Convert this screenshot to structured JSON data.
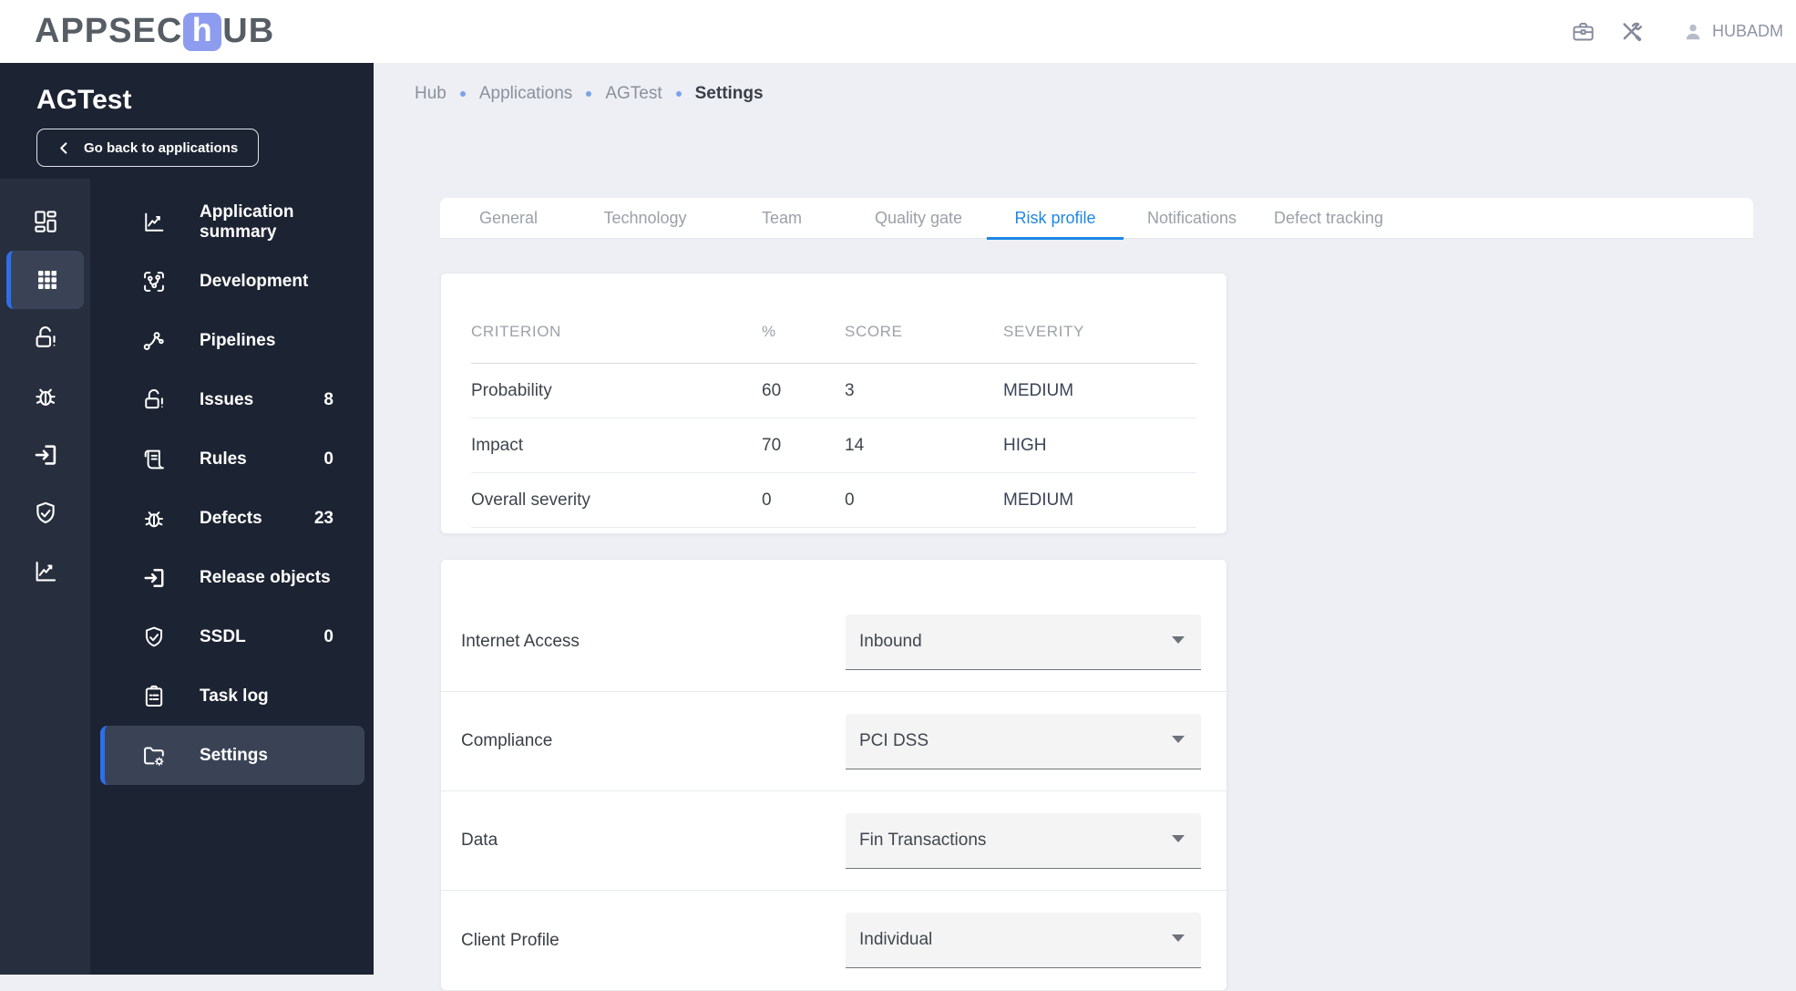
{
  "header": {
    "logo_part1": "APPSEC",
    "logo_accent": "h",
    "logo_part2": "UB",
    "icons": [
      "briefcase-icon",
      "tools-icon"
    ],
    "user_name": "HUBADM"
  },
  "sidebar": {
    "app_name": "AGTest",
    "back_button_label": "Go back to applications",
    "rail": [
      {
        "id": "dashboard",
        "icon": "dashboard-icon",
        "active": false
      },
      {
        "id": "applications",
        "icon": "grid-icon",
        "active": true
      },
      {
        "id": "issues",
        "icon": "lock-alert-icon",
        "active": false
      },
      {
        "id": "defects",
        "icon": "bug-icon",
        "active": false
      },
      {
        "id": "release-objects",
        "icon": "box-arrow-icon",
        "active": false
      },
      {
        "id": "ssdl",
        "icon": "shield-check-icon",
        "active": false
      },
      {
        "id": "summary",
        "icon": "chart-line-icon",
        "active": false
      }
    ],
    "menu": [
      {
        "id": "application-summary",
        "icon": "chart-line-icon",
        "label": "Application summary",
        "count": "",
        "active": false
      },
      {
        "id": "development",
        "icon": "dev-icon",
        "label": "Development",
        "count": "",
        "active": false
      },
      {
        "id": "pipelines",
        "icon": "pipelines-icon",
        "label": "Pipelines",
        "count": "",
        "active": false
      },
      {
        "id": "issues",
        "icon": "lock-alert-icon",
        "label": "Issues",
        "count": "8",
        "active": false
      },
      {
        "id": "rules",
        "icon": "rules-icon",
        "label": "Rules",
        "count": "0",
        "active": false
      },
      {
        "id": "defects",
        "icon": "bug-icon",
        "label": "Defects",
        "count": "23",
        "active": false
      },
      {
        "id": "release-objects",
        "icon": "box-arrow-icon",
        "label": "Release objects",
        "count": "",
        "active": false
      },
      {
        "id": "ssdl",
        "icon": "shield-check-icon",
        "label": "SSDL",
        "count": "0",
        "active": false
      },
      {
        "id": "task-log",
        "icon": "task-log-icon",
        "label": "Task log",
        "count": "",
        "active": false
      },
      {
        "id": "settings",
        "icon": "folder-gear-icon",
        "label": "Settings",
        "count": "",
        "active": true
      }
    ]
  },
  "breadcrumb": [
    {
      "label": "Hub",
      "current": false
    },
    {
      "label": "Applications",
      "current": false
    },
    {
      "label": "AGTest",
      "current": false
    },
    {
      "label": "Settings",
      "current": true
    }
  ],
  "tabs": [
    {
      "label": "General",
      "active": false
    },
    {
      "label": "Technology",
      "active": false
    },
    {
      "label": "Team",
      "active": false
    },
    {
      "label": "Quality gate",
      "active": false
    },
    {
      "label": "Risk profile",
      "active": true
    },
    {
      "label": "Notifications",
      "active": false
    },
    {
      "label": "Defect tracking",
      "active": false
    }
  ],
  "risk_table": {
    "columns": [
      "CRITERION",
      "%",
      "SCORE",
      "SEVERITY"
    ],
    "rows": [
      {
        "criterion": "Probability",
        "percent": "60",
        "score": "3",
        "severity": "MEDIUM"
      },
      {
        "criterion": "Impact",
        "percent": "70",
        "score": "14",
        "severity": "HIGH"
      },
      {
        "criterion": "Overall severity",
        "percent": "0",
        "score": "0",
        "severity": "MEDIUM"
      }
    ]
  },
  "risk_form": {
    "fields": [
      {
        "label": "Internet Access",
        "value": "Inbound"
      },
      {
        "label": "Compliance",
        "value": "PCI DSS"
      },
      {
        "label": "Data",
        "value": "Fin Transactions"
      },
      {
        "label": "Client Profile",
        "value": "Individual"
      }
    ]
  },
  "colors": {
    "accent_blue": "#2c6fed",
    "tab_active_blue": "#1e87e5",
    "logo_accent_bg": "#8d9cee",
    "sidebar_bg": "#1c2332",
    "rail_bg": "#272e3d",
    "active_item_bg": "#3a4356",
    "content_bg": "#edeff5",
    "breadcrumb_dot": "#7aa3e8"
  }
}
